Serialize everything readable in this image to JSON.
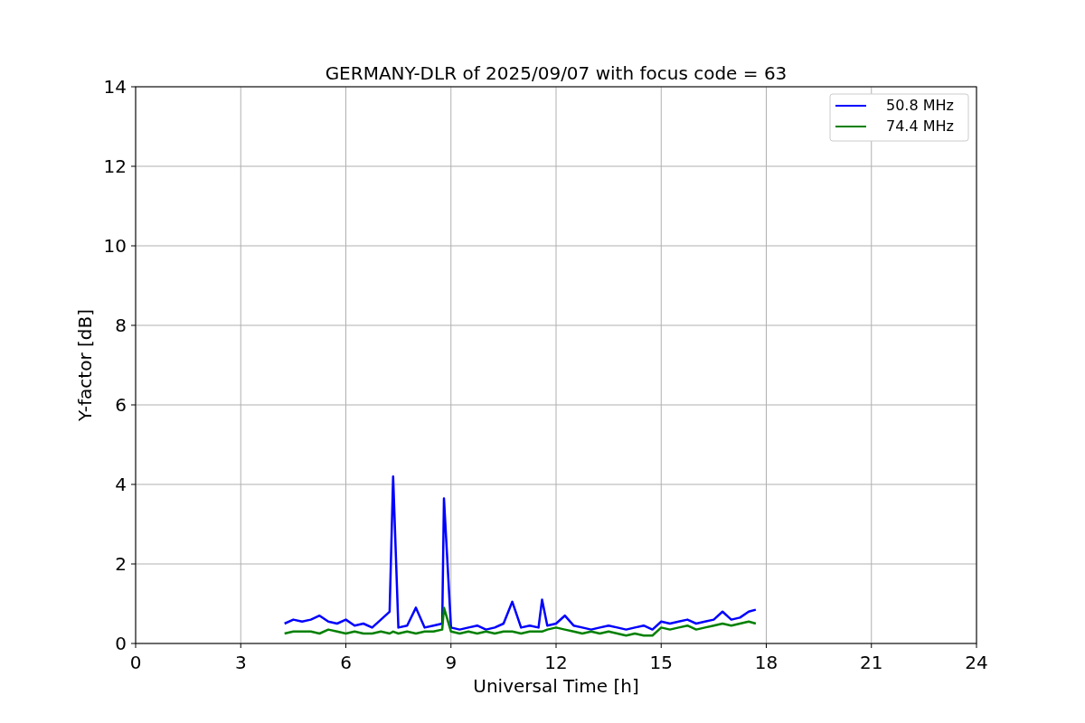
{
  "chart": {
    "chart_data": {
      "type": "line",
      "title": "GERMANY-DLR of 2025/09/07 with focus code = 63",
      "xlabel": "Universal Time [h]",
      "ylabel": "Y-factor [dB]",
      "x": [
        4.25,
        4.5,
        4.75,
        5,
        5.25,
        5.5,
        5.75,
        6,
        6.25,
        6.5,
        6.75,
        7,
        7.25,
        7.35,
        7.5,
        7.75,
        8,
        8.25,
        8.5,
        8.75,
        8.8,
        9,
        9.25,
        9.5,
        9.75,
        10,
        10.25,
        10.5,
        10.75,
        11,
        11.25,
        11.5,
        11.6,
        11.75,
        12,
        12.25,
        12.5,
        12.75,
        13,
        13.25,
        13.5,
        13.75,
        14,
        14.25,
        14.5,
        14.75,
        15,
        15.25,
        15.5,
        15.75,
        16,
        16.25,
        16.5,
        16.75,
        17,
        17.25,
        17.5,
        17.7
      ],
      "series": [
        {
          "name": "50.8 MHz",
          "color": "#0000ff",
          "values": [
            0.5,
            0.6,
            0.55,
            0.6,
            0.7,
            0.55,
            0.5,
            0.6,
            0.45,
            0.5,
            0.4,
            0.6,
            0.8,
            4.2,
            0.4,
            0.45,
            0.9,
            0.4,
            0.45,
            0.5,
            3.65,
            0.4,
            0.35,
            0.4,
            0.45,
            0.35,
            0.4,
            0.5,
            1.05,
            0.4,
            0.45,
            0.4,
            1.1,
            0.45,
            0.5,
            0.7,
            0.45,
            0.4,
            0.35,
            0.4,
            0.45,
            0.4,
            0.35,
            0.4,
            0.45,
            0.35,
            0.55,
            0.5,
            0.55,
            0.6,
            0.5,
            0.55,
            0.6,
            0.8,
            0.6,
            0.65,
            0.8,
            0.85
          ]
        },
        {
          "name": "74.4 MHz",
          "color": "#008000",
          "values": [
            0.25,
            0.3,
            0.3,
            0.3,
            0.25,
            0.35,
            0.3,
            0.25,
            0.3,
            0.25,
            0.25,
            0.3,
            0.25,
            0.3,
            0.25,
            0.3,
            0.25,
            0.3,
            0.3,
            0.35,
            0.9,
            0.3,
            0.25,
            0.3,
            0.25,
            0.3,
            0.25,
            0.3,
            0.3,
            0.25,
            0.3,
            0.3,
            0.3,
            0.35,
            0.4,
            0.35,
            0.3,
            0.25,
            0.3,
            0.25,
            0.3,
            0.25,
            0.2,
            0.25,
            0.2,
            0.2,
            0.4,
            0.35,
            0.4,
            0.45,
            0.35,
            0.4,
            0.45,
            0.5,
            0.45,
            0.5,
            0.55,
            0.5
          ]
        }
      ],
      "grid": true,
      "legend": true,
      "xlim": [
        0,
        24
      ],
      "ylim": [
        0,
        14
      ],
      "xticks": [
        0,
        3,
        6,
        9,
        12,
        15,
        18,
        21,
        24
      ],
      "yticks": [
        0,
        2,
        4,
        6,
        8,
        10,
        12,
        14
      ]
    }
  }
}
